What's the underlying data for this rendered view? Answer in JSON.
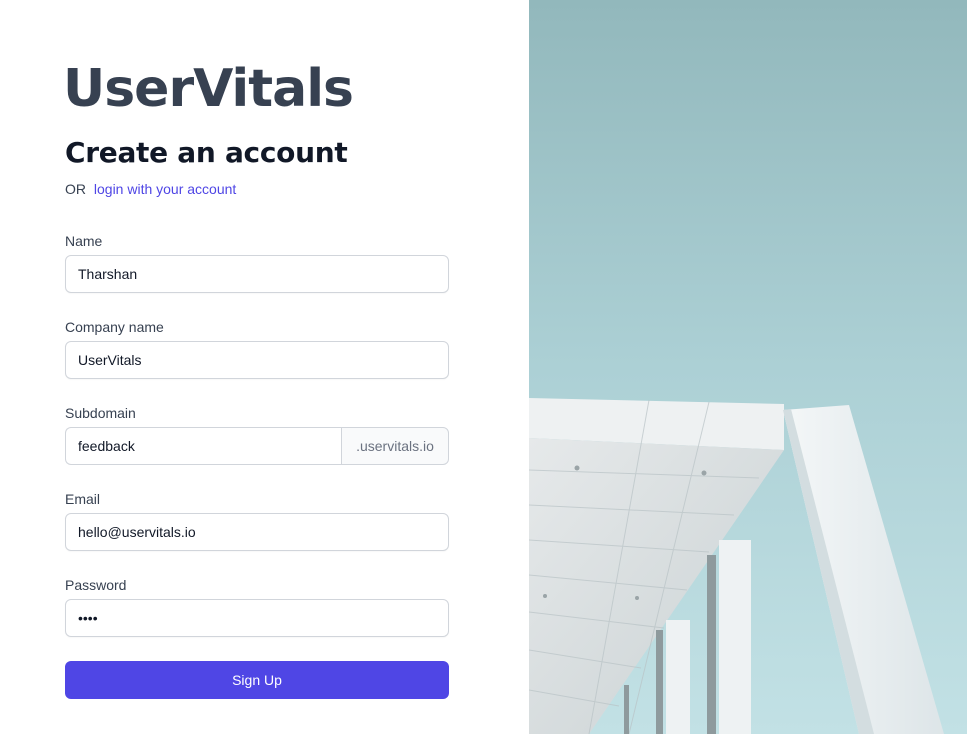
{
  "brand": {
    "name": "UserVitals"
  },
  "heading": "Create an account",
  "alt_prompt": {
    "or": "OR",
    "link": "login with your account"
  },
  "form": {
    "name": {
      "label": "Name",
      "value": "Tharshan"
    },
    "company": {
      "label": "Company name",
      "value": "UserVitals"
    },
    "subdomain": {
      "label": "Subdomain",
      "value": "feedback",
      "suffix": ".uservitals.io"
    },
    "email": {
      "label": "Email",
      "value": "hello@uservitals.io"
    },
    "password": {
      "label": "Password",
      "value": "••••"
    },
    "submit_label": "Sign Up"
  },
  "hero_image": {
    "subject": "architecture-photo"
  },
  "colors": {
    "accent": "#4f46e5",
    "logo": "#374151",
    "sky": "#a9cdd3"
  }
}
